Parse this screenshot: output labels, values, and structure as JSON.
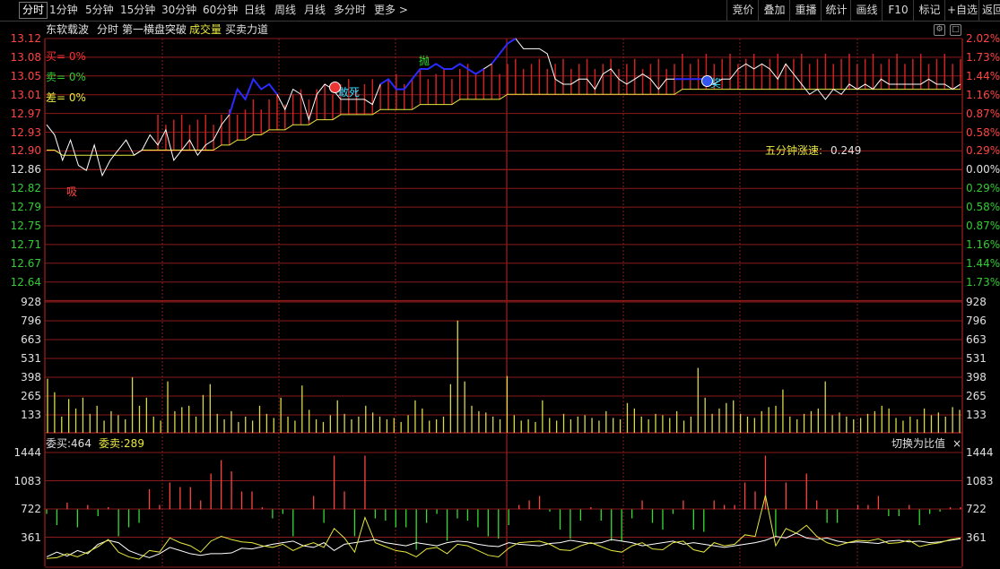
{
  "toolbar": {
    "tabs": [
      "分时",
      "1分钟",
      "5分钟",
      "15分钟",
      "30分钟",
      "60分钟",
      "日线",
      "周线",
      "月线",
      "多分时",
      "更多 >"
    ],
    "right_buttons": [
      "竞价",
      "叠加",
      "重播",
      "统计",
      "画线",
      "F10",
      "标记",
      "+自选",
      "返回"
    ]
  },
  "header": {
    "stock_name": "东软载波",
    "mode": "分时",
    "indicator": "第一横盘突破",
    "volume_label": "成交量",
    "buy_sell_label": "买卖力道"
  },
  "legend": {
    "buy": "买= 0%",
    "sell": "卖= 0%",
    "diff": "差= 0%"
  },
  "speed": {
    "label": "五分钟涨速:",
    "value": "0.249"
  },
  "markers": {
    "xi": "吸",
    "dikan": "敢死",
    "pao": "抛",
    "jiang": "奖"
  },
  "price_axis": {
    "ticks": [
      "13.12",
      "13.08",
      "13.05",
      "13.01",
      "12.97",
      "12.93",
      "12.90",
      "12.86",
      "12.82",
      "12.79",
      "12.75",
      "12.71",
      "12.67",
      "12.64"
    ],
    "pct": [
      "2.02%",
      "1.73%",
      "1.44%",
      "1.16%",
      "0.87%",
      "0.58%",
      "0.29%",
      "0.00%",
      "0.29%",
      "0.58%",
      "0.87%",
      "1.16%",
      "1.44%",
      "1.73%"
    ],
    "base": 12.86
  },
  "volume_axis": {
    "ticks": [
      "928",
      "796",
      "663",
      "531",
      "398",
      "265",
      "133"
    ]
  },
  "order_panel": {
    "wei_mai_label": "委买:464",
    "wei_mai": "委卖:289",
    "switch_label": "切换为比值",
    "close_label": "×",
    "ticks": [
      "1444",
      "1083",
      "722",
      "361"
    ]
  },
  "colors": {
    "up": "#ff3333",
    "down": "#33cc33",
    "grid": "#8b1a1a",
    "price_line": "#ffffff",
    "avg_line": "#e8e840",
    "highlight_line": "#2b2bff",
    "volume_bar": "#d8d84a"
  },
  "chart_data": {
    "type": "line",
    "price_series": [
      12.95,
      12.93,
      12.88,
      12.92,
      12.87,
      12.86,
      12.91,
      12.85,
      12.88,
      12.9,
      12.92,
      12.89,
      12.9,
      12.93,
      12.91,
      12.94,
      12.88,
      12.9,
      12.92,
      12.89,
      12.91,
      12.92,
      12.95,
      12.97,
      13.02,
      13.0,
      13.04,
      13.02,
      13.03,
      13.01,
      12.98,
      13.02,
      13.01,
      12.96,
      13.01,
      13.03,
      13.02,
      13.0,
      13.0,
      13.0,
      13.0,
      12.99,
      13.03,
      13.04,
      13.02,
      13.02,
      13.04,
      13.06,
      13.06,
      13.07,
      13.06,
      13.06,
      13.07,
      13.06,
      13.05,
      13.06,
      13.07,
      13.09,
      13.11,
      13.12,
      13.1,
      13.1,
      13.1,
      13.09,
      13.04,
      13.03,
      13.03,
      13.04,
      13.04,
      13.02,
      13.05,
      13.06,
      13.04,
      13.03,
      13.04,
      13.05,
      13.04,
      13.02,
      13.04,
      13.04,
      13.04,
      13.04,
      13.04,
      13.04,
      13.03,
      13.04,
      13.04,
      13.06,
      13.07,
      13.06,
      13.07,
      13.06,
      13.04,
      13.07,
      13.05,
      13.03,
      13.01,
      13.02,
      13.0,
      13.02,
      13.01,
      13.03,
      13.02,
      13.03,
      13.02,
      13.04,
      13.03,
      13.03,
      13.03,
      13.03,
      13.03,
      13.04,
      13.03,
      13.03,
      13.02,
      13.03
    ],
    "avg_series": [
      12.9,
      12.9,
      12.89,
      12.89,
      12.89,
      12.89,
      12.89,
      12.89,
      12.89,
      12.89,
      12.89,
      12.89,
      12.9,
      12.9,
      12.9,
      12.9,
      12.9,
      12.9,
      12.9,
      12.9,
      12.9,
      12.9,
      12.91,
      12.91,
      12.92,
      12.92,
      12.93,
      12.93,
      12.94,
      12.94,
      12.94,
      12.95,
      12.95,
      12.95,
      12.96,
      12.96,
      12.96,
      12.97,
      12.97,
      12.97,
      12.97,
      12.97,
      12.98,
      12.98,
      12.98,
      12.98,
      12.98,
      12.99,
      12.99,
      12.99,
      12.99,
      12.99,
      13.0,
      13.0,
      13.0,
      13.0,
      13.0,
      13.0,
      13.01,
      13.01,
      13.01,
      13.01,
      13.01,
      13.01,
      13.01,
      13.01,
      13.01,
      13.01,
      13.01,
      13.01,
      13.01,
      13.01,
      13.01,
      13.01,
      13.01,
      13.01,
      13.01,
      13.01,
      13.01,
      13.01,
      13.02,
      13.02,
      13.02,
      13.02,
      13.02,
      13.02,
      13.02,
      13.02,
      13.02,
      13.02,
      13.02,
      13.02,
      13.02,
      13.02,
      13.02,
      13.02,
      13.02,
      13.02,
      13.02,
      13.02,
      13.02,
      13.02,
      13.02,
      13.02,
      13.02,
      13.02,
      13.02,
      13.02,
      13.02,
      13.02,
      13.02,
      13.02,
      13.02,
      13.02,
      13.02,
      13.02
    ],
    "volume": [
      400,
      300,
      120,
      250,
      180,
      260,
      140,
      200,
      90,
      160,
      130,
      100,
      410,
      200,
      260,
      120,
      90,
      380,
      160,
      190,
      200,
      120,
      280,
      360,
      140,
      100,
      160,
      80,
      120,
      90,
      200,
      140,
      110,
      260,
      120,
      90,
      350,
      170,
      100,
      80,
      130,
      240,
      140,
      100,
      120,
      200,
      150,
      120,
      100,
      110,
      80,
      130,
      240,
      180,
      90,
      100,
      120,
      360,
      830,
      380,
      200,
      160,
      150,
      120,
      100,
      420,
      130,
      90,
      100,
      80,
      240,
      110,
      90,
      140,
      100,
      120,
      130,
      110,
      90,
      160,
      110,
      100,
      220,
      180,
      120,
      100,
      140,
      130,
      110,
      160,
      90,
      120,
      480,
      260,
      140,
      180,
      220,
      240,
      140,
      120,
      110,
      160,
      190,
      200,
      320,
      120,
      100,
      140,
      160,
      180,
      380,
      130,
      150,
      120,
      100,
      110,
      140,
      160,
      200,
      180,
      110,
      90,
      120,
      100,
      180,
      130,
      150,
      120,
      190,
      170
    ],
    "order_buy": [
      100,
      110,
      160,
      120,
      180,
      250,
      340,
      180,
      120,
      90,
      200,
      180,
      360,
      300,
      260,
      180,
      320,
      380,
      340,
      310,
      300,
      260,
      240,
      280,
      200,
      260,
      300,
      240,
      480,
      360,
      180,
      620,
      300,
      250,
      200,
      180,
      120,
      220,
      240,
      160,
      280,
      260,
      200,
      140,
      120,
      230,
      300,
      310,
      320,
      280,
      210,
      200,
      260,
      300,
      250,
      200,
      180,
      260,
      300,
      220,
      210,
      300,
      320,
      210,
      180,
      300,
      260,
      280,
      400,
      380,
      900,
      260,
      480,
      420,
      520,
      380,
      300,
      260,
      300,
      330,
      320,
      350,
      290,
      300,
      330,
      250,
      280,
      300,
      340,
      360
    ],
    "order_sell": [
      120,
      180,
      130,
      200,
      160,
      280,
      330,
      300,
      200,
      150,
      110,
      160,
      240,
      200,
      160,
      140,
      160,
      160,
      170,
      230,
      220,
      250,
      280,
      300,
      320,
      260,
      240,
      300,
      200,
      280,
      300,
      320,
      340,
      300,
      280,
      260,
      300,
      280,
      260,
      300,
      320,
      310,
      280,
      260,
      250,
      300,
      280,
      270,
      260,
      290,
      300,
      330,
      310,
      290,
      300,
      340,
      320,
      300,
      260,
      280,
      300,
      320,
      280,
      300,
      280,
      260,
      240,
      260,
      280,
      300,
      330,
      380,
      360,
      420,
      360,
      340,
      360,
      320,
      300,
      310,
      300,
      290,
      320,
      330,
      310,
      320,
      300,
      310,
      330,
      350
    ],
    "ylim": [
      12.6,
      13.14
    ]
  }
}
